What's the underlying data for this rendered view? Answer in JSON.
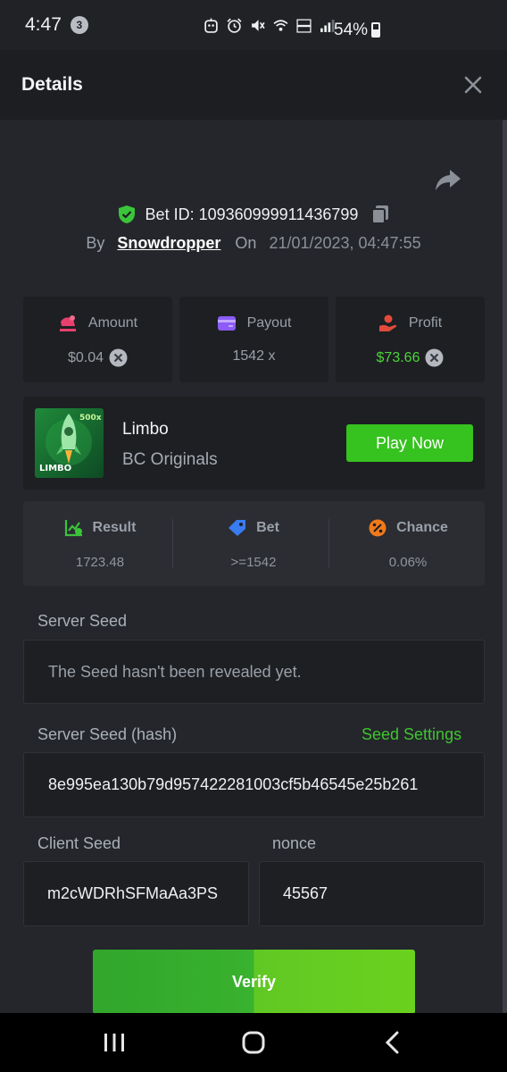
{
  "status_bar": {
    "time": "4:47",
    "notification_count": "3",
    "battery": "54%"
  },
  "header": {
    "title": "Details"
  },
  "bet": {
    "id_label": "Bet ID: 109360999911436799",
    "by_label": "By",
    "username": "Snowdropper",
    "on_label": "On",
    "date": "21/01/2023, 04:47:55"
  },
  "stats": {
    "amount": {
      "label": "Amount",
      "value": "$0.04"
    },
    "payout": {
      "label": "Payout",
      "value": "1542 x"
    },
    "profit": {
      "label": "Profit",
      "value": "$73.66"
    }
  },
  "game": {
    "name": "Limbo",
    "provider": "BC Originals",
    "thumb_badge": "500x",
    "thumb_title": "LIMBO",
    "play_label": "Play Now"
  },
  "results": {
    "result": {
      "label": "Result",
      "value": "1723.48"
    },
    "bet": {
      "label": "Bet",
      "value": ">=1542"
    },
    "chance": {
      "label": "Chance",
      "value": "0.06%"
    }
  },
  "seeds": {
    "server_seed_label": "Server Seed",
    "server_seed_value": "The Seed hasn't been revealed yet.",
    "server_hash_label": "Server Seed (hash)",
    "seed_settings_label": "Seed Settings",
    "server_hash_value": "8e995ea130b79d957422281003cf5b46545e25b261",
    "client_seed_label": "Client Seed",
    "client_seed_value": "m2cWDRhSFMaAa3PS",
    "nonce_label": "nonce",
    "nonce_value": "45567"
  },
  "verify_label": "Verify",
  "colors": {
    "accent_green": "#36c21f",
    "profit_green": "#4ed43a",
    "amount_pink": "#e8406e",
    "payout_purple": "#8b5cf6",
    "profit_red": "#e24b3b",
    "bet_blue": "#3a7bf0",
    "chance_orange": "#f07a1a"
  }
}
